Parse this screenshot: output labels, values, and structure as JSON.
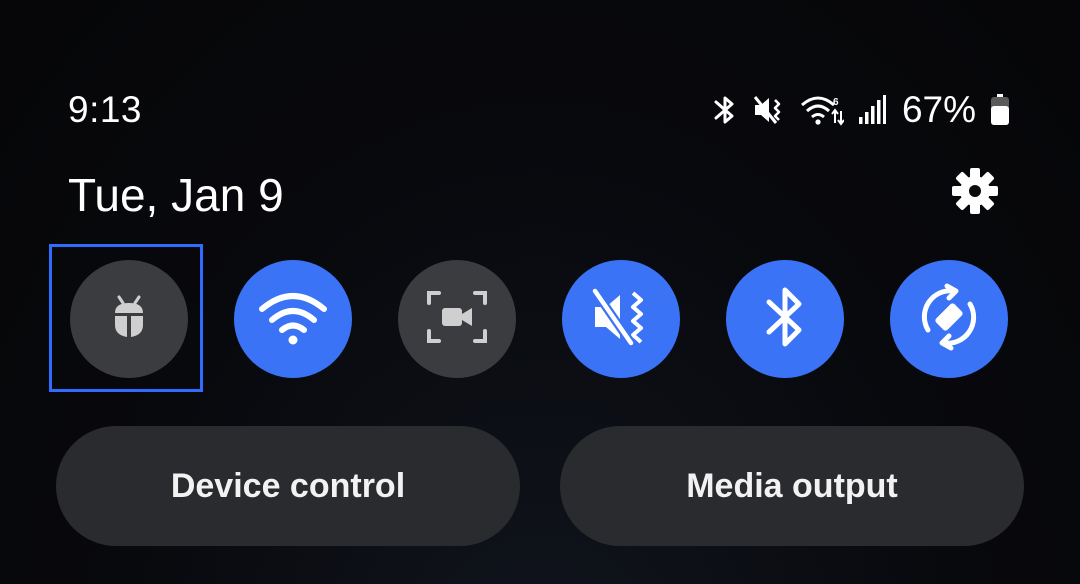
{
  "status_bar": {
    "time": "9:13",
    "battery_percent": "67%",
    "battery_level": 0.67,
    "icons": [
      "bluetooth-icon",
      "mute-vibrate-icon",
      "wifi-data-icon",
      "signal-icon",
      "battery-icon"
    ]
  },
  "header": {
    "date": "Tue, Jan 9"
  },
  "quick_tiles": [
    {
      "name": "bug-tile",
      "icon": "bug-icon",
      "state": "off",
      "focused": true
    },
    {
      "name": "wifi-tile",
      "icon": "wifi-icon",
      "state": "on"
    },
    {
      "name": "screen-recorder-tile",
      "icon": "screen-record-icon",
      "state": "off"
    },
    {
      "name": "sound-mode-tile",
      "icon": "mute-vibrate-icon",
      "state": "on"
    },
    {
      "name": "bluetooth-tile",
      "icon": "bluetooth-icon",
      "state": "on"
    },
    {
      "name": "auto-rotate-tile",
      "icon": "rotate-icon",
      "state": "on"
    }
  ],
  "buttons": {
    "device_control": "Device control",
    "media_output": "Media output"
  },
  "colors": {
    "accent": "#3a73f5",
    "tile_off": "#3b3c3f",
    "focus": "#2f6bff",
    "pill": "#2a2b2e"
  }
}
